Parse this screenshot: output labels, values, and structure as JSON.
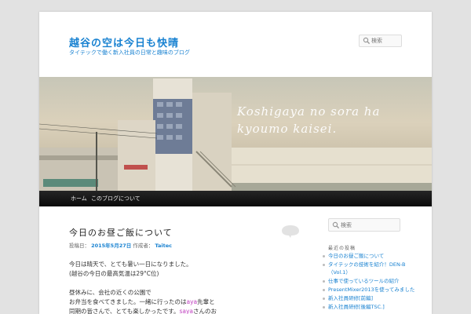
{
  "site": {
    "title": "越谷の空は今日も快晴",
    "description": "タイテックで働く新入社員の日常と趣味のブログ"
  },
  "search": {
    "placeholder": "検索"
  },
  "header": {
    "caption_line1": "Koshigaya no sora ha",
    "caption_line2": "kyoumo kaisei."
  },
  "nav": {
    "items": [
      "ホーム",
      "このブログについて"
    ]
  },
  "post": {
    "title": "今日のお昼ご飯について",
    "meta_prefix": "投稿日：",
    "date": "2015年5月27日",
    "author_prefix": "作成者：",
    "author": "Taitec",
    "lines": [
      "今日は晴天で、とても暑い一日になりました。",
      "(越谷の今日の最高気温は29°C位)",
      "",
      "昼休みに、会社の近くの公園で",
      "お弁当を食べてきました。一緒に行ったのはaya先輩と",
      "同期の皆さんで、とても楽しかったです。sayaさんのお"
    ]
  },
  "sidebar": {
    "search_placeholder": "検索",
    "widget_title": "最近の投稿",
    "recent_posts": [
      "今日のお昼ご飯について",
      "タイテックの技術を紹介！DEN-B（Vol.1）",
      "仕事で使っているツールの紹介",
      "PresentMixer2013を使ってみました",
      "新入社員研修[前編]",
      "新入社員研修[後編TSC.]"
    ]
  },
  "colors": {
    "link": "#1982d1",
    "highlight": "#c040c0",
    "nav_bg": "#111111"
  },
  "icons": {
    "search": "magnifier-icon",
    "comment": "comment-bubble-icon"
  }
}
